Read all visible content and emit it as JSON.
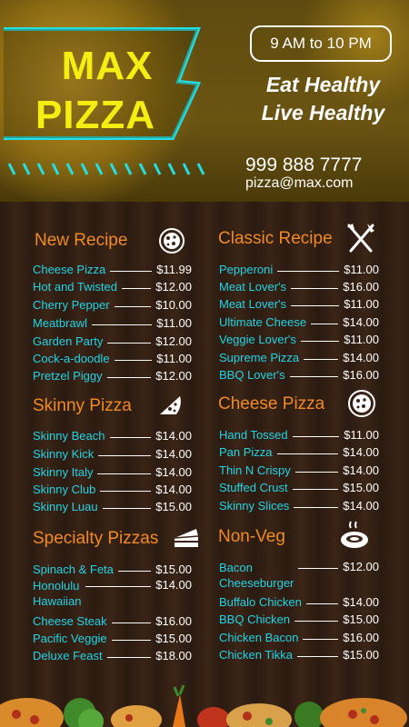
{
  "header": {
    "brand_line1": "MAX",
    "brand_line2": "PIZZA",
    "hours": "9 AM to 10 PM",
    "tagline1": "Eat Healthy",
    "tagline2": "Live Healthy",
    "phone": "999 888 7777",
    "email": "pizza@max.com"
  },
  "sections": {
    "new_recipe": {
      "title": "New Recipe",
      "icon": "pizza-icon",
      "items": [
        {
          "name": "Cheese Pizza",
          "price": "$11.99"
        },
        {
          "name": "Hot and Twisted",
          "price": "$12.00"
        },
        {
          "name": "Cherry Pepper",
          "price": "$10.00"
        },
        {
          "name": "Meatbrawl",
          "price": "$11.00"
        },
        {
          "name": "Garden Party",
          "price": "$12.00"
        },
        {
          "name": "Cock-a-doodle",
          "price": "$11.00"
        },
        {
          "name": "Pretzel Piggy",
          "price": "$12.00"
        }
      ]
    },
    "classic_recipe": {
      "title": "Classic Recipe",
      "icon": "fork-knife-icon",
      "items": [
        {
          "name": "Pepperoni",
          "price": "$11.00"
        },
        {
          "name": "Meat Lover's",
          "price": "$16.00"
        },
        {
          "name": "Meat Lover's",
          "price": "$11.00"
        },
        {
          "name": "Ultimate Cheese",
          "price": "$14.00"
        },
        {
          "name": "Veggie Lover's",
          "price": "$11.00"
        },
        {
          "name": "Supreme Pizza",
          "price": "$14.00"
        },
        {
          "name": "BBQ Lover's",
          "price": "$16.00"
        }
      ]
    },
    "skinny_pizza": {
      "title": "Skinny Pizza",
      "icon": "pizza-slice-icon",
      "items": [
        {
          "name": "Skinny Beach",
          "price": "$14.00"
        },
        {
          "name": "Skinny Kick",
          "price": "$14.00"
        },
        {
          "name": "Skinny Italy",
          "price": "$14.00"
        },
        {
          "name": "Skinny Club",
          "price": "$14.00"
        },
        {
          "name": "Skinny Luau",
          "price": "$15.00"
        }
      ]
    },
    "cheese_pizza": {
      "title": "Cheese Pizza",
      "icon": "pizza-icon",
      "items": [
        {
          "name": "Hand Tossed",
          "price": "$11.00"
        },
        {
          "name": "Pan Pizza",
          "price": "$14.00"
        },
        {
          "name": "Thin N Crispy",
          "price": "$14.00"
        },
        {
          "name": "Stuffed Crust",
          "price": "$15.00"
        },
        {
          "name": "Skinny Slices",
          "price": "$14.00"
        }
      ]
    },
    "specialty_pizzas": {
      "title": "Specialty Pizzas",
      "icon": "cake-slice-icon",
      "items": [
        {
          "name": "Spinach & Feta",
          "price": "$15.00"
        },
        {
          "name": "Honolulu Hawaiian",
          "name_line1": "Honolulu",
          "name_line2": "Hawaiian",
          "price": "$14.00"
        },
        {
          "name": "Cheese Steak",
          "price": "$16.00"
        },
        {
          "name": "Pacific Veggie",
          "price": "$15.00"
        },
        {
          "name": "Deluxe Feast",
          "price": "$18.00"
        }
      ]
    },
    "non_veg": {
      "title": "Non-Veg",
      "icon": "steak-icon",
      "items": [
        {
          "name": "Bacon Cheeseburger",
          "name_line1": "Bacon",
          "name_line2": "Cheeseburger",
          "price": "$12.00"
        },
        {
          "name": "Buffalo Chicken",
          "price": "$14.00"
        },
        {
          "name": "BBQ Chicken",
          "price": "$15.00"
        },
        {
          "name": "Chicken Bacon",
          "price": "$16.00"
        },
        {
          "name": "Chicken Tikka",
          "price": "$15.00"
        }
      ]
    }
  },
  "colors": {
    "brand_yellow": "#f5ee12",
    "accent_cyan": "#22d4e6",
    "section_orange": "#f08a24",
    "price_white": "#ffffff"
  }
}
